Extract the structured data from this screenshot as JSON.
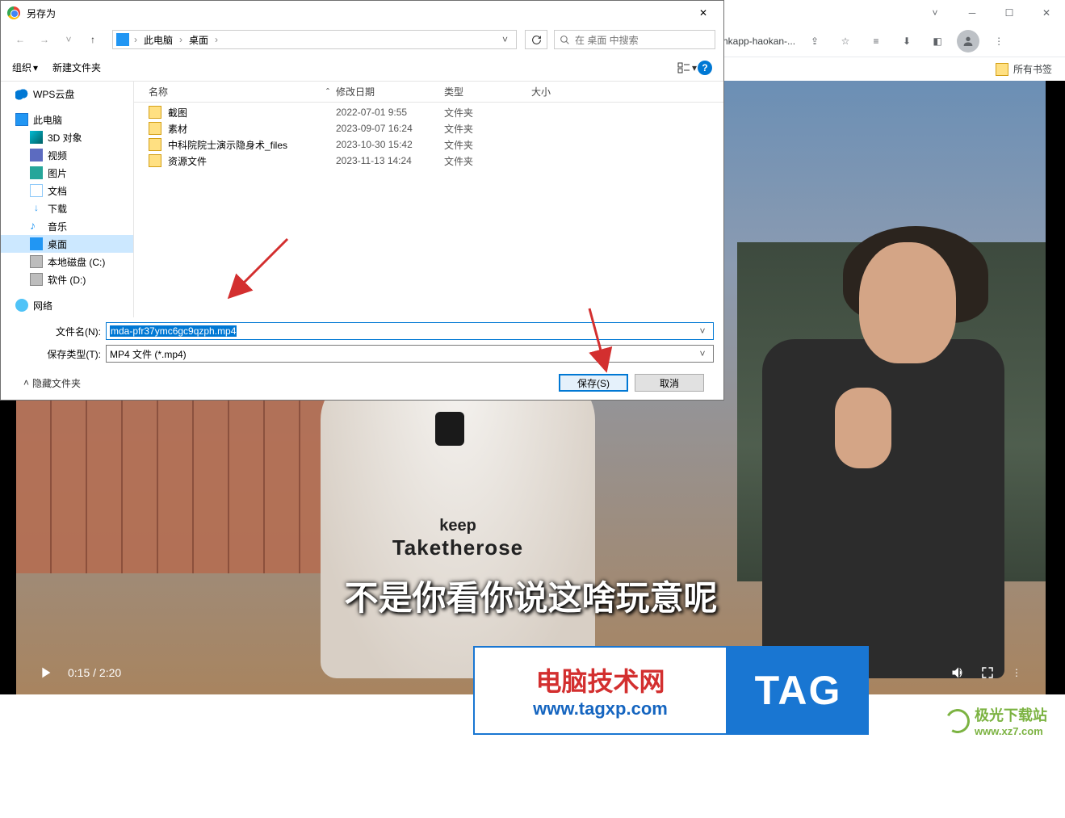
{
  "chrome": {
    "tab_text": "hkapp-haokan-...",
    "bookmark": "所有书签"
  },
  "dialog": {
    "title": "另存为",
    "nav": {
      "pc": "此电脑",
      "desktop": "桌面"
    },
    "search_placeholder": "在 桌面 中搜索",
    "toolbar": {
      "organize": "组织",
      "new_folder": "新建文件夹"
    },
    "columns": {
      "name": "名称",
      "date": "修改日期",
      "type": "类型",
      "size": "大小"
    },
    "tree": {
      "wps": "WPS云盘",
      "pc": "此电脑",
      "obj3d": "3D 对象",
      "video": "视频",
      "pictures": "图片",
      "docs": "文档",
      "downloads": "下载",
      "music": "音乐",
      "desktop": "桌面",
      "diskc": "本地磁盘 (C:)",
      "diskd": "软件 (D:)",
      "network": "网络"
    },
    "files": [
      {
        "name": "截图",
        "date": "2022-07-01 9:55",
        "type": "文件夹"
      },
      {
        "name": "素材",
        "date": "2023-09-07 16:24",
        "type": "文件夹"
      },
      {
        "name": "中科院院士演示隐身术_files",
        "date": "2023-10-30 15:42",
        "type": "文件夹"
      },
      {
        "name": "资源文件",
        "date": "2023-11-13 14:24",
        "type": "文件夹"
      }
    ],
    "filename_label": "文件名(N):",
    "filetype_label": "保存类型(T):",
    "filename_value": "mda-pfr37ymc6gc9qzph.mp4",
    "filetype_value": "MP4 文件 (*.mp4)",
    "hide_folders": "隐藏文件夹",
    "save": "保存(S)",
    "cancel": "取消"
  },
  "video": {
    "shirt_l1": "keep",
    "shirt_l2": "Taketherose",
    "subtitle": "不是你看你说这啥玩意呢",
    "time": "0:15 / 2:20"
  },
  "watermark": {
    "t1": "电脑技术网",
    "t2": "www.tagxp.com",
    "tag": "TAG",
    "jg_cn": "极光下载站",
    "jg_url": "www.xz7.com"
  }
}
